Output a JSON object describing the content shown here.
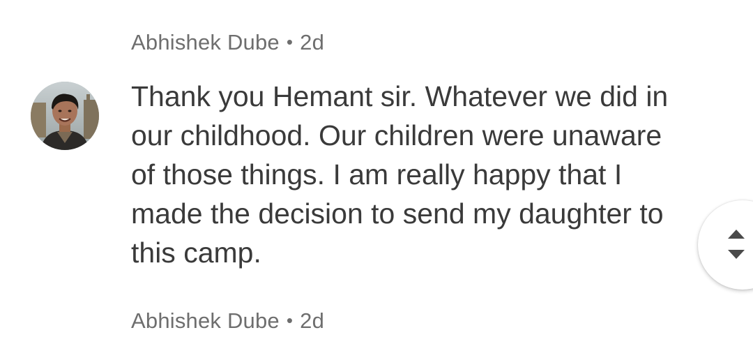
{
  "comments": [
    {
      "author": "Abhishek Dube",
      "separator": "•",
      "age": "2d",
      "avatar_icon": "person-photo-avatar",
      "text_lines": [
        "Thank you Hemant sir. Whatever we did in",
        "our childhood. Our children were unaware",
        "of those things. I am really happy that I",
        "made the decision to send my daughter to",
        "this camp."
      ]
    },
    {
      "author": "Abhishek Dube",
      "separator": "•",
      "age": "2d"
    }
  ],
  "scroll_control": {
    "up_icon": "caret-up-icon",
    "down_icon": "caret-down-icon"
  },
  "colors": {
    "meta_text": "#6e6e6e",
    "body_text": "#3a3a3a",
    "background": "#ffffff"
  }
}
